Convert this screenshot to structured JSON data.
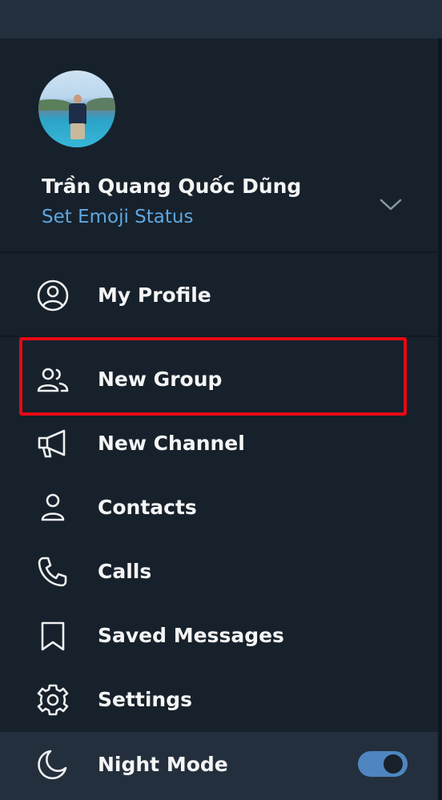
{
  "user": {
    "name": "Trần Quang Quốc Dũng",
    "status_link": "Set Emoji Status"
  },
  "menu": {
    "my_profile": "My Profile",
    "new_group": "New Group",
    "new_channel": "New Channel",
    "contacts": "Contacts",
    "calls": "Calls",
    "saved_messages": "Saved Messages",
    "settings": "Settings",
    "night_mode": "Night Mode"
  },
  "night_mode_enabled": true,
  "icons": {
    "account": "account-circle-icon",
    "group": "group-icon",
    "channel": "megaphone-icon",
    "contacts": "person-icon",
    "calls": "phone-icon",
    "saved": "bookmark-icon",
    "settings": "gear-icon",
    "night": "moon-icon",
    "expand": "chevron-down-icon"
  },
  "colors": {
    "background": "#17212b",
    "accent": "#5fa7e1",
    "toggle": "#4f86c0",
    "highlight": "#e50914"
  }
}
